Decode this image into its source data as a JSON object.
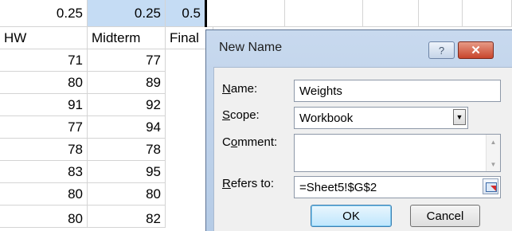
{
  "sheet": {
    "top_row": [
      "0.25",
      "0.25",
      "0.5"
    ],
    "headers": [
      "HW",
      "Midterm",
      "Final"
    ],
    "rows": [
      [
        "71",
        "77"
      ],
      [
        "80",
        "89"
      ],
      [
        "91",
        "92"
      ],
      [
        "77",
        "94"
      ],
      [
        "78",
        "78"
      ],
      [
        "83",
        "95"
      ],
      [
        "80",
        "80"
      ],
      [
        "80",
        "82"
      ]
    ]
  },
  "dialog": {
    "title": "New Name",
    "help_glyph": "?",
    "close_glyph": "✕",
    "name_label": "Name:",
    "name_value": "Weights",
    "scope_label": "Scope:",
    "scope_value": "Workbook",
    "comment_label": "Comment:",
    "comment_value": "",
    "refers_label": "Refers to:",
    "refers_value": "=Sheet5!$G$2",
    "ok_label": "OK",
    "cancel_label": "Cancel"
  },
  "colors": {
    "selection": "#c5dcf4",
    "dialog_frame": "#b5cbe6",
    "close_button": "#c8462d"
  },
  "icons": [
    "help-icon",
    "close-icon",
    "dropdown-arrow-icon",
    "scroll-up-icon",
    "scroll-down-icon",
    "range-select-icon"
  ]
}
